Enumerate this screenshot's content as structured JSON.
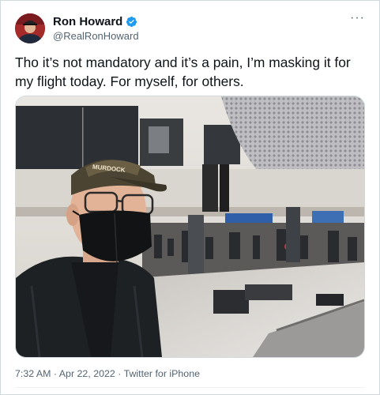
{
  "author": {
    "name": "Ron Howard",
    "handle": "@RealRonHoward",
    "avatar_icon": "profile-photo",
    "verified_icon": "verified-badge-icon"
  },
  "menu": {
    "more_label": "···"
  },
  "tweet": {
    "text": "Tho it’s not mandatory and it’s a pain, I’m masking it for my flight today. For myself, for others.",
    "media": {
      "type": "photo",
      "description_icon": "selfie-photo",
      "cap_text": "MURDOCK"
    }
  },
  "meta": {
    "time": "7:32 AM",
    "separator": " · ",
    "date": "Apr 22, 2022",
    "source": "Twitter for iPhone"
  },
  "colors": {
    "brand_blue": "#1d9bf0",
    "text_primary": "#0f1419",
    "text_secondary": "#536471",
    "border": "#cfd9de"
  }
}
